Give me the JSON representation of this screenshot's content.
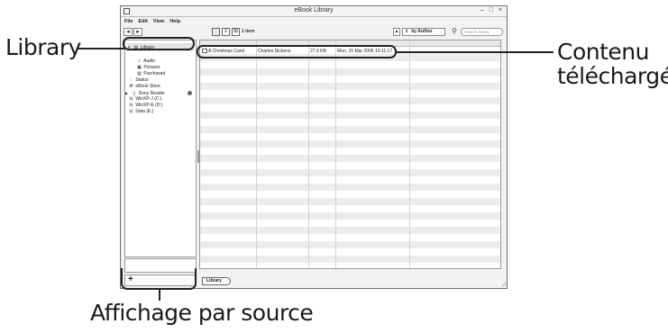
{
  "window": {
    "title": "eBook Library",
    "controls": "– □ ×"
  },
  "menu": [
    "File",
    "Edit",
    "View",
    "Help"
  ],
  "toolbar": {
    "back": "◂",
    "forward": "▸",
    "item_count": "1 item",
    "sort_direction": "▲",
    "sort_by": "by Author",
    "search_placeholder": "Search library"
  },
  "sidebar": {
    "items": [
      {
        "label": "Library",
        "icon": "library-icon",
        "glyph": "▤",
        "expand": "▼"
      },
      {
        "label": "Audio",
        "icon": "music-note-icon",
        "glyph": "♫"
      },
      {
        "label": "Pictures",
        "icon": "picture-icon",
        "glyph": "▣"
      },
      {
        "label": "Purchased",
        "icon": "purchased-icon",
        "glyph": "▥"
      },
      {
        "label": "Status",
        "icon": "status-icon",
        "glyph": "◌"
      },
      {
        "label": "eBook Store",
        "icon": "store-icon",
        "glyph": "⌘"
      },
      {
        "label": "Sony Reader",
        "icon": "reader-icon",
        "glyph": "▯",
        "expand": "▶"
      },
      {
        "label": "WinXP-J (C:)",
        "icon": "drive-icon",
        "glyph": "⊟"
      },
      {
        "label": "WinXP-E (D:)",
        "icon": "drive-icon",
        "glyph": "⊟"
      },
      {
        "label": "Data (E:)",
        "icon": "drive-icon",
        "glyph": "⊟"
      }
    ],
    "add_label": "+"
  },
  "list": {
    "rows": [
      {
        "title": "A Christmas Carol",
        "author": "Charles Dickens",
        "size": "27.6 KB",
        "date": "Mon, 15 Mar 2006 10:11:17"
      }
    ]
  },
  "bottom_tab": "Library",
  "callouts": {
    "library": "Library",
    "contenu_line1": "Contenu",
    "contenu_line2": "téléchargé",
    "source": "Affichage par source"
  }
}
